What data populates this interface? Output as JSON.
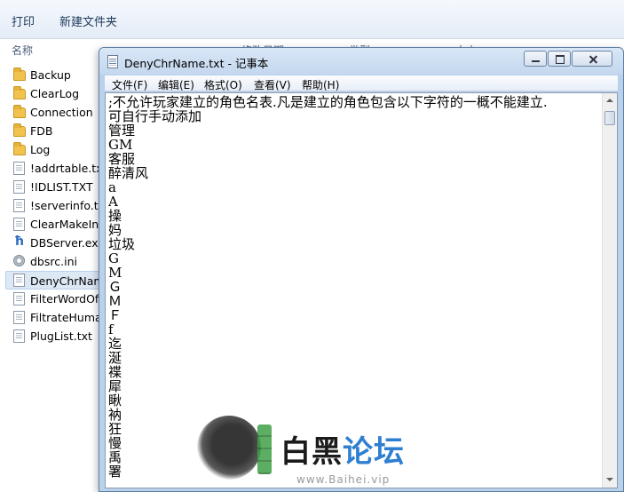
{
  "explorer": {
    "toolbar": {
      "print": "打印",
      "new_folder": "新建文件夹"
    },
    "columns": {
      "name": "名称",
      "date": "修改日期",
      "type": "类型",
      "size": "大小"
    },
    "files": [
      {
        "name": "Backup",
        "icon": "folder-icon"
      },
      {
        "name": "ClearLog",
        "icon": "folder-icon"
      },
      {
        "name": "Connection",
        "icon": "folder-icon"
      },
      {
        "name": "FDB",
        "icon": "folder-icon"
      },
      {
        "name": "Log",
        "icon": "folder-icon"
      },
      {
        "name": "!addrtable.txt",
        "icon": "text-file-icon"
      },
      {
        "name": "!IDLIST.TXT",
        "icon": "text-file-icon"
      },
      {
        "name": "!serverinfo.txt",
        "icon": "text-file-icon"
      },
      {
        "name": "ClearMakeInd",
        "icon": "text-file-icon"
      },
      {
        "name": "DBServer.exe",
        "icon": "exe-file-icon"
      },
      {
        "name": "dbsrc.ini",
        "icon": "ini-file-icon"
      },
      {
        "name": "DenyChrNam",
        "icon": "text-file-icon",
        "selected": true
      },
      {
        "name": "FilterWordOfl",
        "icon": "text-file-icon"
      },
      {
        "name": "FiltrateHuman",
        "icon": "text-file-icon"
      },
      {
        "name": "PlugList.txt",
        "icon": "text-file-icon"
      }
    ]
  },
  "notepad": {
    "title": "DenyChrName.txt - 记事本",
    "menu": {
      "file": "文件(F)",
      "edit": "编辑(E)",
      "format": "格式(O)",
      "view": "查看(V)",
      "help": "帮助(H)"
    },
    "lines": [
      ";不允许玩家建立的角色名表.凡是建立的角色包含以下字符的一概不能建立.",
      "可自行手动添加",
      "管理",
      "GM",
      "客服",
      "醉清风",
      "a",
      "A",
      "操",
      "妈",
      "垃圾",
      "G",
      "M",
      "Ｇ",
      "Ｍ",
      "Ｆ",
      "f",
      "迄",
      "涎",
      "褋",
      "犀",
      "瞅",
      "衲",
      "狂",
      "慢",
      "禹",
      "署"
    ]
  },
  "watermark": {
    "part1": "白黑",
    "part2": "论坛",
    "url": "www.Baihei.vip"
  }
}
